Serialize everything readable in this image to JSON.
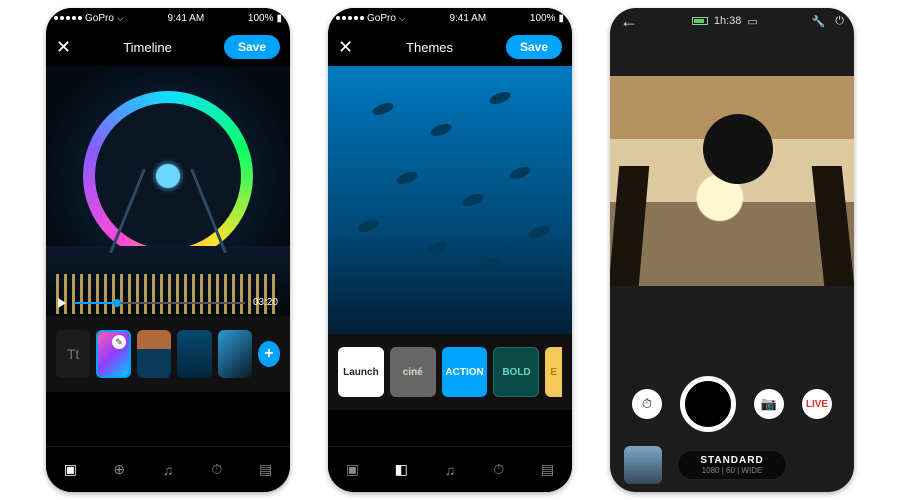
{
  "statusbar": {
    "carrier": "GoPro",
    "time": "9:41 AM",
    "battery": "100%"
  },
  "timeline": {
    "title": "Timeline",
    "save_label": "Save",
    "duration": "03:20",
    "text_chip": "Tt",
    "add_label": "+"
  },
  "themes": {
    "title": "Themes",
    "save_label": "Save",
    "chips": {
      "launch": "Launch",
      "cine": "ciné",
      "action": "ACTION",
      "bold": "BOLD",
      "elite": "E"
    }
  },
  "nav_icons": [
    "clips-icon",
    "add-clip-icon",
    "music-icon",
    "speed-icon",
    "layout-icon"
  ],
  "camera": {
    "time": "1h:38",
    "controls": {
      "live": "LIVE"
    },
    "mode": {
      "name": "STANDARD",
      "detail": "1080 | 60 | WIDE"
    }
  }
}
